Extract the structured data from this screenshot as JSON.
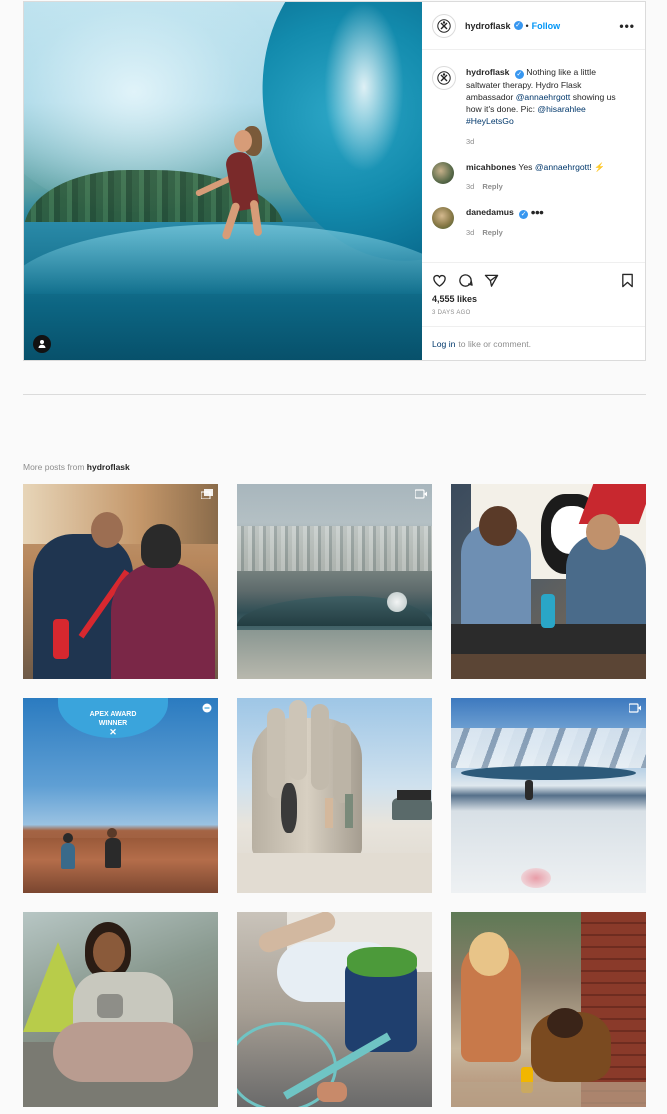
{
  "post": {
    "username": "hydroflask",
    "follow_label": "Follow",
    "caption_username": "hydroflask",
    "caption_text": "Nothing like a little saltwater therapy. Hydro Flask ambassador",
    "caption_mention": "@annaehrgott",
    "caption_text2": "showing us how it's done. Pic:",
    "caption_mention2": "@hisarahlee",
    "caption_hashtag": "#HeyLetsGo",
    "caption_age": "3d",
    "comments": [
      {
        "username": "micahbones",
        "text_prefix": "Yes",
        "mention": "@annaehrgott!",
        "emoji": "⚡",
        "age": "3d",
        "reply": "Reply"
      },
      {
        "username": "danedamus",
        "text": "●●●",
        "age": "3d",
        "reply": "Reply"
      }
    ],
    "likes": "4,555 likes",
    "posted_ago": "3 DAYS AGO",
    "login_link": "Log in",
    "login_text": "to like or comment."
  },
  "more_posts": {
    "prefix": "More posts from",
    "username": "hydroflask"
  },
  "grid_badges": [
    "carousel",
    "video",
    "",
    "carousel",
    "",
    "video",
    "",
    "",
    ""
  ],
  "tile4_badge_text": "APEX AWARD",
  "tile4_badge_text2": "WINNER",
  "colors": {
    "accent": "#0095f6",
    "verified": "#3897f0",
    "mention": "#00376b"
  }
}
